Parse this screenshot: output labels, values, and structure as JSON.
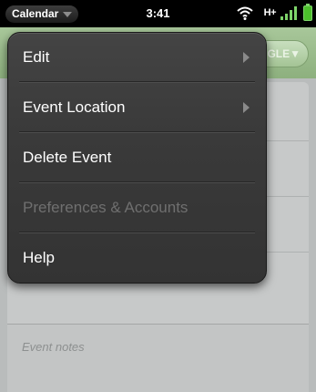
{
  "status_bar": {
    "app_menu_label": "Calendar",
    "time": "3:41",
    "network": "H+",
    "icons": [
      "wifi-icon",
      "signal-icon",
      "battery-icon"
    ]
  },
  "background_app": {
    "header_pill_label": "GLE▼",
    "event_notes_placeholder": "Event notes"
  },
  "menu": {
    "items": [
      {
        "label": "Edit",
        "has_submenu": true,
        "enabled": true
      },
      {
        "label": "Event Location",
        "has_submenu": true,
        "enabled": true
      },
      {
        "label": "Delete Event",
        "has_submenu": false,
        "enabled": true
      },
      {
        "label": "Preferences & Accounts",
        "has_submenu": false,
        "enabled": false
      },
      {
        "label": "Help",
        "has_submenu": false,
        "enabled": true
      }
    ]
  },
  "colors": {
    "menu_bg": "#3a3a3a",
    "header_green": "#9dbd8f",
    "disabled_text": "#6f6f6f"
  }
}
